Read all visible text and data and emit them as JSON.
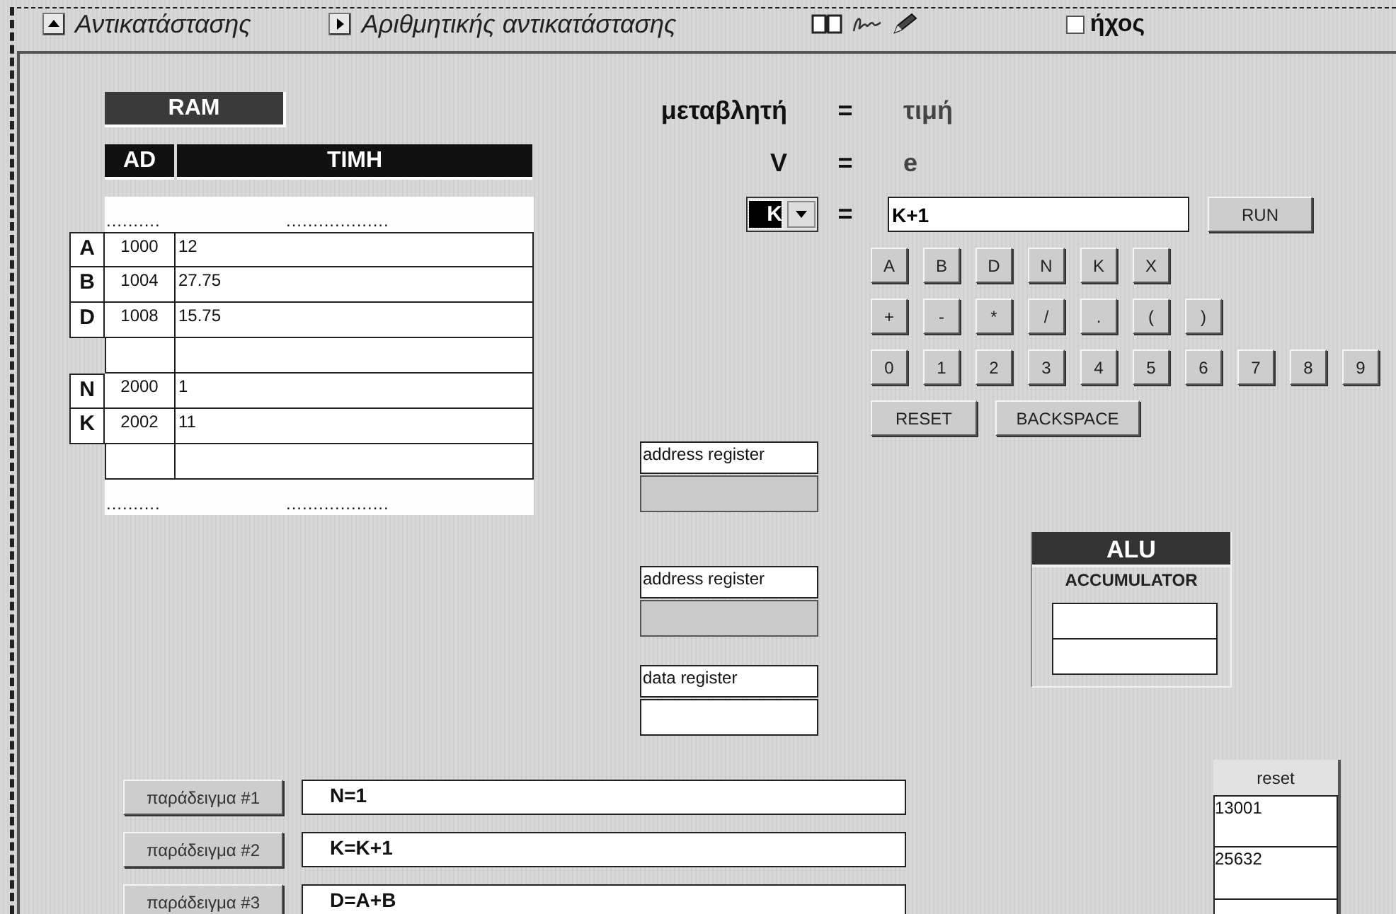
{
  "toolbar": {
    "buttons": [
      {
        "label": "Αντικατάστασης",
        "kind": "up"
      },
      {
        "label": "Αριθμητικής αντικατάστασης",
        "kind": "play"
      }
    ],
    "tools": [
      {
        "kind": "book"
      },
      {
        "kind": "signature"
      },
      {
        "kind": "pencil"
      }
    ],
    "sound": {
      "label": "ήχος",
      "checked": false
    }
  },
  "ram": {
    "title": "RAM",
    "columns": [
      "AD",
      "TIMH"
    ],
    "dots": [
      "..........",
      "..................."
    ],
    "rows": [
      {
        "kind": "entry",
        "variable": "A",
        "address": "1000",
        "value": "12"
      },
      {
        "kind": "entry",
        "variable": "B",
        "address": "1004",
        "value": "27.75"
      },
      {
        "kind": "entry",
        "variable": "D",
        "address": "1008",
        "value": "15.75"
      },
      {
        "kind": "blank"
      },
      {
        "kind": "entry",
        "variable": "N",
        "address": "2000",
        "value": "1"
      },
      {
        "kind": "entry",
        "variable": "K",
        "address": "2002",
        "value": "11"
      },
      {
        "kind": "blank"
      }
    ],
    "bottom_dots": [
      "..........",
      "..................."
    ]
  },
  "assignment": {
    "header": [
      "μεταβλητή",
      "=",
      "τιμή"
    ],
    "form": [
      "V",
      "=",
      "e"
    ],
    "variable": "K",
    "equals": "=",
    "expression": "K+1",
    "run": "RUN"
  },
  "keypad": {
    "rows": [
      [
        "A",
        "B",
        "D",
        "N",
        "K",
        "X"
      ],
      [
        "+",
        "-",
        "*",
        "/",
        ".",
        "(",
        ")"
      ],
      [
        "0",
        "1",
        "2",
        "3",
        "4",
        "5",
        "6",
        "7",
        "8",
        "9"
      ]
    ],
    "actions": [
      "RESET",
      "BACKSPACE"
    ]
  },
  "registers": [
    {
      "label": "address register",
      "kind": "gray"
    },
    {
      "label": "address register",
      "kind": "gray"
    },
    {
      "label": "data register",
      "kind": "white"
    }
  ],
  "alu": {
    "title": "ALU",
    "subtitle": "ACCUMULATOR"
  },
  "examples": [
    {
      "button": "παράδειγμα #1",
      "code": "N=1"
    },
    {
      "button": "παράδειγμα #2",
      "code": "K=K+1"
    },
    {
      "button": "παράδειγμα #3",
      "code": "D=A+B"
    }
  ],
  "history": {
    "reset": "reset",
    "values": [
      "13001",
      "25632"
    ]
  }
}
